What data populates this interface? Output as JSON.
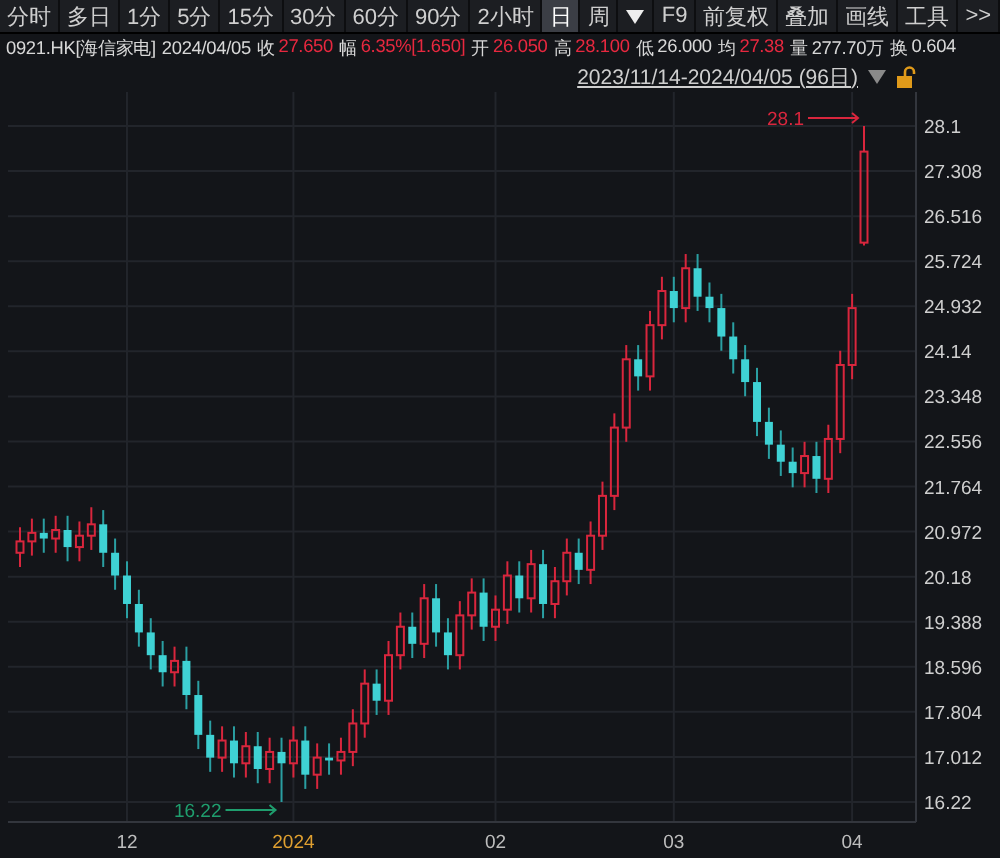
{
  "toolbar": {
    "periods": [
      {
        "label": "分时",
        "selected": false
      },
      {
        "label": "多日",
        "selected": false
      },
      {
        "label": "1分",
        "selected": false
      },
      {
        "label": "5分",
        "selected": false
      },
      {
        "label": "15分",
        "selected": false
      },
      {
        "label": "30分",
        "selected": false
      },
      {
        "label": "60分",
        "selected": false
      },
      {
        "label": "90分",
        "selected": false
      },
      {
        "label": "2小时",
        "selected": false
      },
      {
        "label": "日",
        "selected": true
      },
      {
        "label": "周",
        "selected": false
      }
    ],
    "tools": [
      "F9",
      "前复权",
      "叠加",
      "画线",
      "工具",
      ">>"
    ]
  },
  "quote": {
    "symbol": "0921.HK[海信家电]",
    "date": "2024/04/05",
    "fields": [
      {
        "label": "收",
        "value": "27.650",
        "color": "#e8283f"
      },
      {
        "label": "幅",
        "value": "6.35%[1.650]",
        "color": "#e8283f"
      },
      {
        "label": "开",
        "value": "26.050",
        "color": "#e8283f"
      },
      {
        "label": "高",
        "value": "28.100",
        "color": "#e8283f"
      },
      {
        "label": "低",
        "value": "26.000",
        "color": "#d8d8d8"
      },
      {
        "label": "均",
        "value": "27.38",
        "color": "#e8283f"
      },
      {
        "label": "量",
        "value": "277.70万",
        "color": "#d8d8d8"
      },
      {
        "label": "换",
        "value": "0.604",
        "color": "#d8d8d8"
      }
    ]
  },
  "range": {
    "text": "2023/11/14-2024/04/05 (96日)",
    "locked": false
  },
  "chart": {
    "chart_data": {
      "type": "candlestick",
      "grid": true,
      "ylim": [
        16.22,
        28.1
      ],
      "yticks": [
        28.1,
        27.308,
        26.516,
        25.724,
        24.932,
        24.14,
        23.348,
        22.556,
        21.764,
        20.972,
        20.18,
        19.388,
        18.596,
        17.804,
        17.012,
        16.22
      ],
      "categories": [
        null,
        null,
        null,
        null,
        null,
        null,
        null,
        null,
        null,
        "12",
        null,
        null,
        null,
        null,
        null,
        null,
        null,
        null,
        null,
        null,
        null,
        null,
        null,
        "2024",
        null,
        null,
        null,
        null,
        null,
        null,
        null,
        null,
        null,
        null,
        null,
        null,
        null,
        null,
        null,
        null,
        "02",
        null,
        null,
        null,
        null,
        null,
        null,
        null,
        null,
        null,
        null,
        null,
        null,
        null,
        null,
        "03",
        null,
        null,
        null,
        null,
        null,
        null,
        null,
        null,
        null,
        null,
        null,
        null,
        null,
        null,
        "04",
        null
      ],
      "ohlc": [
        [
          20.6,
          21.05,
          20.35,
          20.8
        ],
        [
          20.8,
          21.2,
          20.55,
          20.95
        ],
        [
          20.95,
          21.2,
          20.6,
          20.85
        ],
        [
          20.85,
          21.25,
          20.6,
          21.0
        ],
        [
          21.0,
          21.25,
          20.45,
          20.7
        ],
        [
          20.7,
          21.15,
          20.45,
          20.9
        ],
        [
          20.9,
          21.4,
          20.65,
          21.1
        ],
        [
          21.1,
          21.35,
          20.35,
          20.6
        ],
        [
          20.6,
          20.85,
          19.95,
          20.2
        ],
        [
          20.2,
          20.45,
          19.45,
          19.7
        ],
        [
          19.7,
          19.95,
          18.95,
          19.2
        ],
        [
          19.2,
          19.45,
          18.55,
          18.8
        ],
        [
          18.8,
          19.05,
          18.25,
          18.5
        ],
        [
          18.5,
          18.95,
          18.25,
          18.7
        ],
        [
          18.7,
          18.95,
          17.85,
          18.1
        ],
        [
          18.1,
          18.35,
          17.15,
          17.4
        ],
        [
          17.4,
          17.65,
          16.75,
          17.0
        ],
        [
          17.0,
          17.55,
          16.75,
          17.3
        ],
        [
          17.3,
          17.55,
          16.65,
          16.9
        ],
        [
          16.9,
          17.45,
          16.65,
          17.2
        ],
        [
          17.2,
          17.45,
          16.55,
          16.8
        ],
        [
          16.8,
          17.35,
          16.55,
          17.1
        ],
        [
          17.1,
          17.35,
          16.22,
          16.9
        ],
        [
          16.9,
          17.55,
          16.65,
          17.3
        ],
        [
          17.3,
          17.55,
          16.45,
          16.7
        ],
        [
          16.7,
          17.25,
          16.45,
          17.0
        ],
        [
          17.0,
          17.25,
          16.7,
          16.95
        ],
        [
          16.95,
          17.35,
          16.7,
          17.1
        ],
        [
          17.1,
          17.85,
          16.85,
          17.6
        ],
        [
          17.6,
          18.55,
          17.35,
          18.3
        ],
        [
          18.3,
          18.55,
          17.75,
          18.0
        ],
        [
          18.0,
          19.05,
          17.75,
          18.8
        ],
        [
          18.8,
          19.55,
          18.55,
          19.3
        ],
        [
          19.3,
          19.55,
          18.75,
          19.0
        ],
        [
          19.0,
          20.05,
          18.75,
          19.8
        ],
        [
          19.8,
          20.05,
          18.95,
          19.2
        ],
        [
          19.2,
          19.45,
          18.55,
          18.8
        ],
        [
          18.8,
          19.75,
          18.55,
          19.5
        ],
        [
          19.5,
          20.15,
          19.25,
          19.9
        ],
        [
          19.9,
          20.15,
          19.05,
          19.3
        ],
        [
          19.3,
          19.85,
          19.05,
          19.6
        ],
        [
          19.6,
          20.45,
          19.35,
          20.2
        ],
        [
          20.2,
          20.45,
          19.55,
          19.8
        ],
        [
          19.8,
          20.65,
          19.55,
          20.4
        ],
        [
          20.4,
          20.65,
          19.45,
          19.7
        ],
        [
          19.7,
          20.35,
          19.45,
          20.1
        ],
        [
          20.1,
          20.85,
          19.85,
          20.6
        ],
        [
          20.6,
          20.85,
          20.05,
          20.3
        ],
        [
          20.3,
          21.15,
          20.05,
          20.9
        ],
        [
          20.9,
          21.85,
          20.65,
          21.6
        ],
        [
          21.6,
          23.05,
          21.35,
          22.8
        ],
        [
          22.8,
          24.25,
          22.55,
          24.0
        ],
        [
          24.0,
          24.25,
          23.45,
          23.7
        ],
        [
          23.7,
          24.85,
          23.45,
          24.6
        ],
        [
          24.6,
          25.45,
          24.35,
          25.2
        ],
        [
          25.2,
          25.45,
          24.65,
          24.9
        ],
        [
          24.9,
          25.85,
          24.65,
          25.6
        ],
        [
          25.6,
          25.85,
          24.85,
          25.1
        ],
        [
          25.1,
          25.35,
          24.65,
          24.9
        ],
        [
          24.9,
          25.15,
          24.15,
          24.4
        ],
        [
          24.4,
          24.65,
          23.75,
          24.0
        ],
        [
          24.0,
          24.25,
          23.35,
          23.6
        ],
        [
          23.6,
          23.85,
          22.65,
          22.9
        ],
        [
          22.9,
          23.15,
          22.25,
          22.5
        ],
        [
          22.5,
          22.75,
          21.95,
          22.2
        ],
        [
          22.2,
          22.45,
          21.75,
          22.0
        ],
        [
          22.0,
          22.55,
          21.75,
          22.3
        ],
        [
          22.3,
          22.55,
          21.65,
          21.9
        ],
        [
          21.9,
          22.85,
          21.65,
          22.6
        ],
        [
          22.6,
          24.15,
          22.35,
          23.9
        ],
        [
          23.9,
          25.15,
          23.65,
          24.9
        ],
        [
          26.05,
          28.1,
          26.0,
          27.65
        ]
      ],
      "annotations": [
        "28.1",
        "16.22"
      ]
    },
    "axis_label_highlight": [
      false,
      true,
      false,
      false,
      false
    ]
  }
}
